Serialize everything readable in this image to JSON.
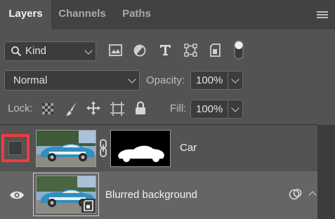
{
  "tabs": [
    {
      "label": "Layers",
      "active": true
    },
    {
      "label": "Channels",
      "active": false
    },
    {
      "label": "Paths",
      "active": false
    }
  ],
  "filter": {
    "kind_label": "Kind",
    "icons": [
      "search-icon",
      "image-filter-icon",
      "adjustment-filter-icon",
      "type-filter-icon",
      "shape-filter-icon",
      "smart-object-filter-icon",
      "filter-toggle-icon"
    ]
  },
  "blend": {
    "mode": "Normal",
    "opacity_label": "Opacity:",
    "opacity_value": "100%"
  },
  "lock": {
    "label": "Lock:",
    "fill_label": "Fill:",
    "fill_value": "100%"
  },
  "layers": [
    {
      "name": "Car",
      "visible": false,
      "has_mask": true,
      "smart_object": false
    },
    {
      "name": "Blurred background",
      "visible": true,
      "has_mask": false,
      "smart_object": true
    }
  ],
  "colors": {
    "panel": "#535353",
    "highlight": "#f03c3c",
    "selected_row": "#656565"
  }
}
